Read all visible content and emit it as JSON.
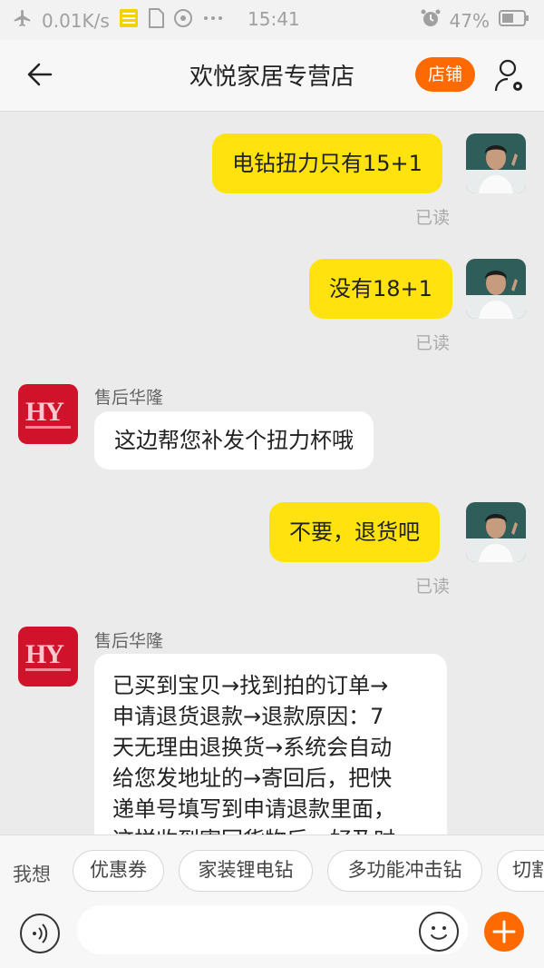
{
  "status_bar": {
    "network_speed": "0.01K/s",
    "time": "15:41",
    "battery": "47%"
  },
  "header": {
    "title": "欢悦家居专营店",
    "shop_button": "店铺"
  },
  "messages": [
    {
      "from": "me",
      "text": "电钻扭力只有15+1",
      "status": "已读"
    },
    {
      "from": "me",
      "text": "没有18+1",
      "status": "已读"
    },
    {
      "from": "shop",
      "sender": "售后华隆",
      "text": "这边帮您补发个扭力杯哦"
    },
    {
      "from": "me",
      "text": "不要，退货吧",
      "status": "已读"
    },
    {
      "from": "shop",
      "sender": "售后华隆",
      "lines": [
        "已买到宝贝→找到拍的订单→",
        "申请退货退款→退款原因：7",
        "天无理由退换货→系统会自动",
        "给您发地址的→寄回后，把快",
        "递单号填写到申请退款里面，",
        "这样收到寄回货物后，好及时"
      ]
    }
  ],
  "quick_bar": {
    "label": "我想",
    "chips": [
      "优惠券",
      "家装锂电钻",
      "多功能冲击钻",
      "切割"
    ]
  },
  "input": {
    "placeholder": ""
  },
  "colors": {
    "accent": "#ff6a00",
    "my_bubble": "#ffe20e",
    "shop_avatar": "#d0122a"
  }
}
